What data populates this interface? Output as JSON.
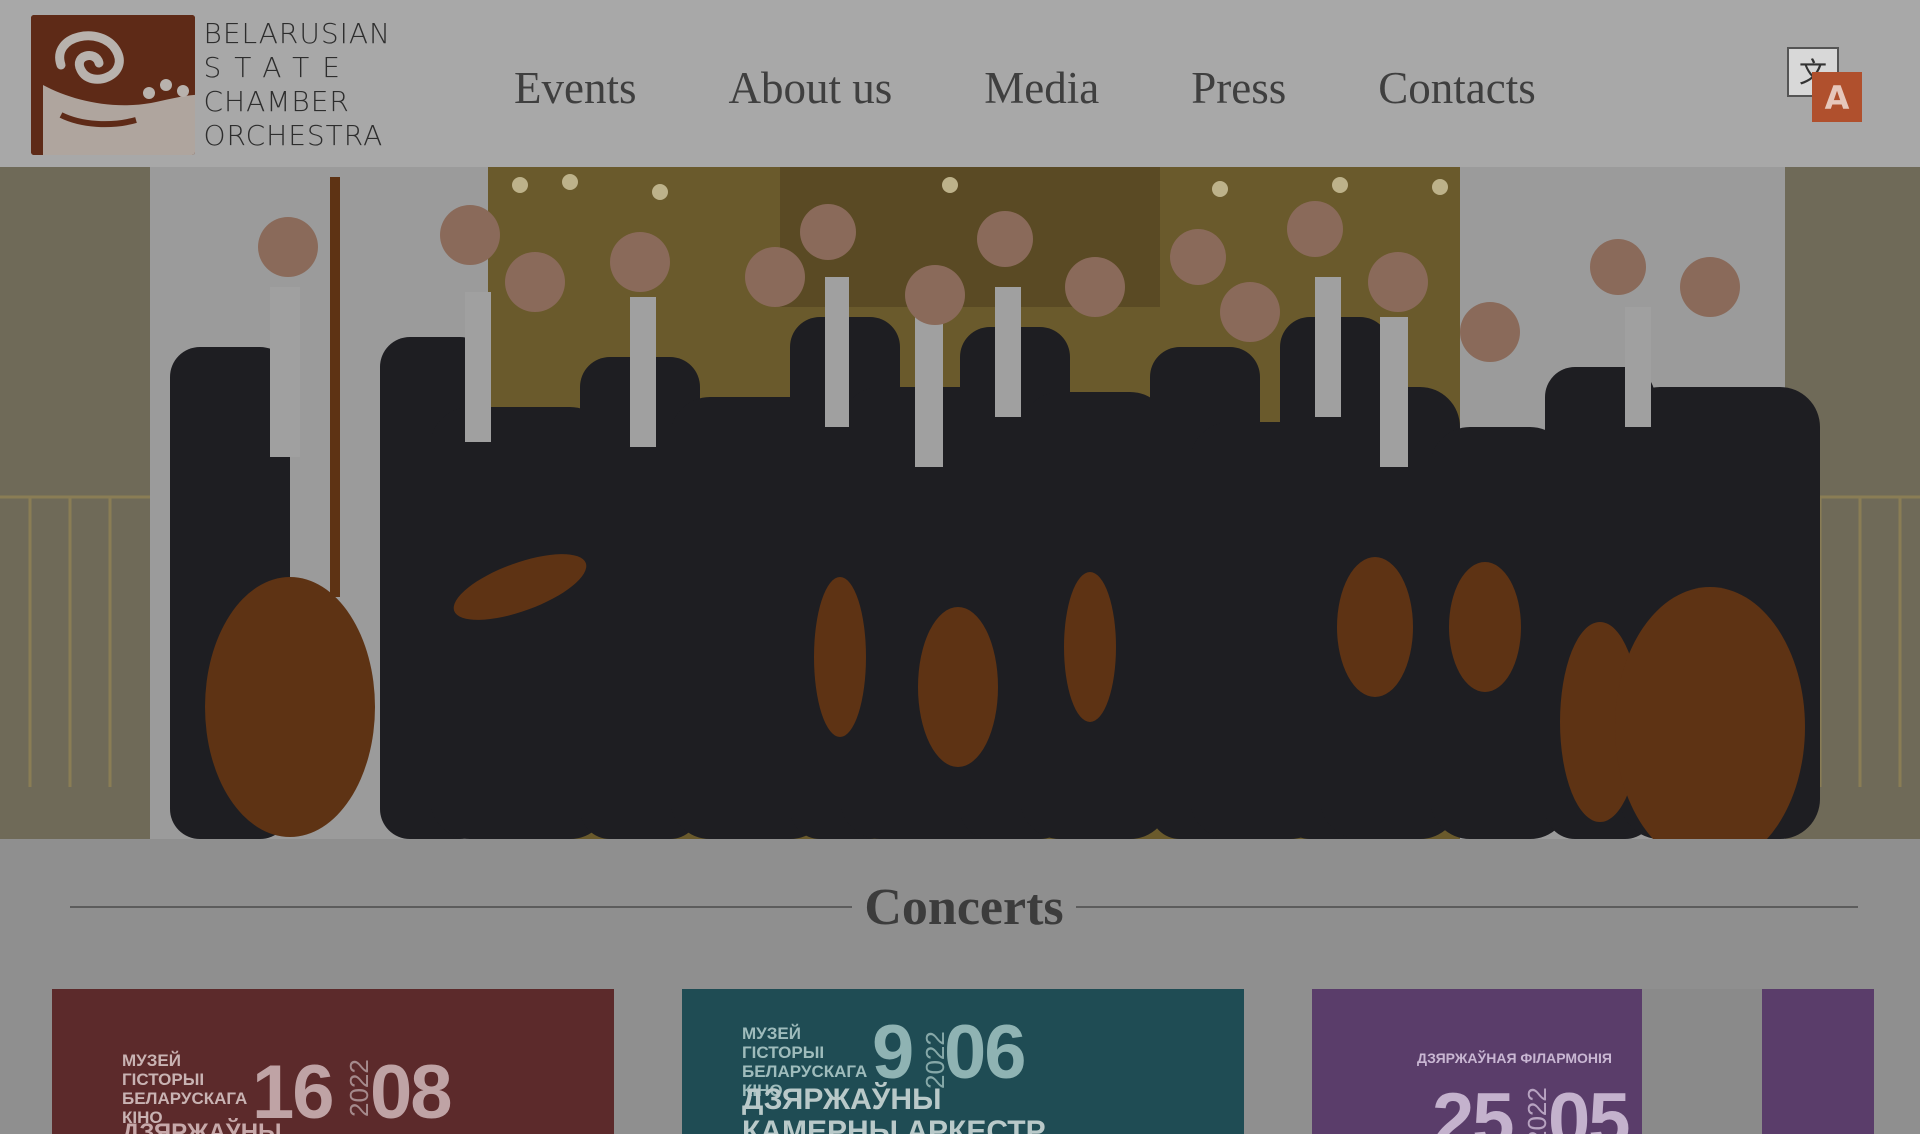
{
  "brand": {
    "line1": "BELARUSIAN",
    "line2": "STATE",
    "line3": "CHAMBER",
    "line4": "ORCHESTRA",
    "color": "#8a3c20"
  },
  "nav": {
    "items": [
      "Events",
      "About us",
      "Media",
      "Press",
      "Contacts"
    ]
  },
  "translate": {
    "icon": "translate-icon",
    "glyph_cn": "文",
    "glyph_a": "A",
    "accent": "#c4582f"
  },
  "concerts": {
    "title": "Concerts",
    "cards": [
      {
        "venue": "МУЗЕЙ ГІСТОРЫІ БЕЛАРУСКАГА КІНО",
        "day": "16",
        "year": "2022",
        "month": "08",
        "extra": "ДЗЯРЖАЎНЫ",
        "color": "#8e3b3e"
      },
      {
        "venue": "МУЗЕЙ ГІСТОРЫІ БЕЛАРУСКАГА КІНО",
        "day": "9",
        "year": "2022",
        "month": "06",
        "extra": "ДЗЯРЖАЎНЫ КАМЕРНЫ АРКЕСТР",
        "color": "#2c6e78"
      },
      {
        "venue": "ДЗЯРЖАЎНАЯ ФІЛАРМОНІЯ",
        "day": "25",
        "year": "2022",
        "month": "05",
        "extra": "",
        "color": "#7e5696"
      }
    ]
  }
}
